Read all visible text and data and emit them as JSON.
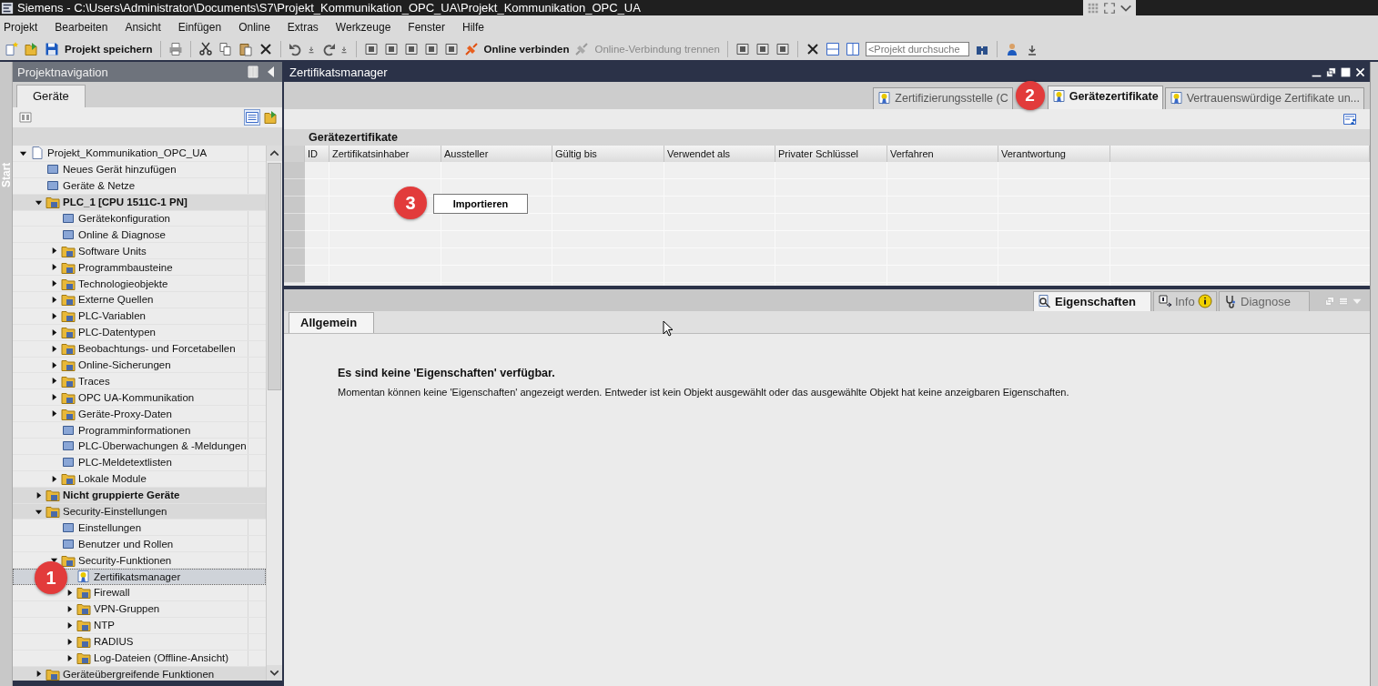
{
  "window": {
    "title": "Siemens  -  C:\\Users\\Administrator\\Documents\\S7\\Projekt_Kommunikation_OPC_UA\\Projekt_Kommunikation_OPC_UA"
  },
  "menu": [
    "Projekt",
    "Bearbeiten",
    "Ansicht",
    "Einfügen",
    "Online",
    "Extras",
    "Werkzeuge",
    "Fenster",
    "Hilfe"
  ],
  "toolbar": {
    "save": {
      "label": "Projekt speichern",
      "disabled": false
    },
    "connect": {
      "label": "Online verbinden",
      "disabled": false
    },
    "disconnect": {
      "label": "Online-Verbindung trennen",
      "disabled": true
    },
    "search": {
      "placeholder": "<Projekt durchsuche"
    }
  },
  "start_strip": {
    "label": "Start"
  },
  "navigation": {
    "title": "Projektnavigation",
    "tabs": [
      {
        "label": "Geräte",
        "selected": true
      }
    ],
    "tree": [
      {
        "label": "Projekt_Kommunikation_OPC_UA",
        "expanded": true,
        "selected": false,
        "children": [
          {
            "label": "Neues Gerät hinzufügen",
            "selected": false
          },
          {
            "label": "Geräte & Netze",
            "selected": false
          },
          {
            "label": "PLC_1 [CPU 1511C-1 PN]",
            "expanded": true,
            "bold": true,
            "selected": false,
            "children": [
              {
                "label": "Gerätekonfiguration",
                "selected": false
              },
              {
                "label": "Online & Diagnose",
                "selected": false
              },
              {
                "label": "Software Units",
                "expanded": false,
                "selected": false
              },
              {
                "label": "Programmbausteine",
                "expanded": false,
                "selected": false
              },
              {
                "label": "Technologieobjekte",
                "expanded": false,
                "selected": false
              },
              {
                "label": "Externe Quellen",
                "expanded": false,
                "selected": false
              },
              {
                "label": "PLC-Variablen",
                "expanded": false,
                "selected": false
              },
              {
                "label": "PLC-Datentypen",
                "expanded": false,
                "selected": false
              },
              {
                "label": "Beobachtungs- und Forcetabellen",
                "expanded": false,
                "selected": false
              },
              {
                "label": "Online-Sicherungen",
                "expanded": false,
                "selected": false
              },
              {
                "label": "Traces",
                "expanded": false,
                "selected": false
              },
              {
                "label": "OPC UA-Kommunikation",
                "expanded": false,
                "selected": false
              },
              {
                "label": "Geräte-Proxy-Daten",
                "expanded": false,
                "selected": false
              },
              {
                "label": "Programminformationen",
                "selected": false
              },
              {
                "label": "PLC-Überwachungen & -Meldungen",
                "selected": false
              },
              {
                "label": "PLC-Meldetextlisten",
                "selected": false
              },
              {
                "label": "Lokale Module",
                "expanded": false,
                "selected": false
              }
            ]
          },
          {
            "label": "Nicht gruppierte Geräte",
            "expanded": false,
            "bold": true,
            "selected": false
          },
          {
            "label": "Security-Einstellungen",
            "expanded": true,
            "selected": false,
            "children": [
              {
                "label": "Einstellungen",
                "selected": false
              },
              {
                "label": "Benutzer und Rollen",
                "selected": false
              },
              {
                "label": "Security-Funktionen",
                "expanded": true,
                "selected": false,
                "children": [
                  {
                    "label": "Zertifikatsmanager",
                    "selected": true
                  },
                  {
                    "label": "Firewall",
                    "expanded": false,
                    "selected": false
                  },
                  {
                    "label": "VPN-Gruppen",
                    "expanded": false,
                    "selected": false
                  },
                  {
                    "label": "NTP",
                    "expanded": false,
                    "selected": false
                  },
                  {
                    "label": "RADIUS",
                    "expanded": false,
                    "selected": false
                  },
                  {
                    "label": "Log-Dateien (Offline-Ansicht)",
                    "expanded": false,
                    "selected": false
                  }
                ]
              }
            ]
          },
          {
            "label": "Geräteübergreifende Funktionen",
            "expanded": false,
            "selected": false
          }
        ]
      }
    ]
  },
  "editor": {
    "title": "Zertifikatsmanager",
    "tabs": [
      {
        "label": "Zertifizierungsstelle (C",
        "selected": false
      },
      {
        "label": "Gerätezertifikate",
        "selected": true
      },
      {
        "label": "Vertrauenswürdige Zertifikate un...",
        "selected": false
      }
    ],
    "table": {
      "title": "Gerätezertifikate",
      "columns": [
        "ID",
        "Zertifikatsinhaber",
        "Aussteller",
        "Gültig bis",
        "Verwendet als",
        "Privater Schlüssel",
        "Verfahren",
        "Verantwortung"
      ]
    },
    "import_button": "Importieren"
  },
  "inspector": {
    "tabs": [
      {
        "label": "Eigenschaften",
        "selected": true
      },
      {
        "label": "Info",
        "selected": false
      },
      {
        "label": "Diagnose",
        "selected": false
      }
    ],
    "subtabs": [
      {
        "label": "Allgemein",
        "selected": true
      }
    ],
    "heading": "Es sind keine 'Eigenschaften' verfügbar.",
    "message": "Momentan können keine 'Eigenschaften' angezeigt werden. Entweder ist kein Objekt ausgewählt oder das ausgewählte Objekt hat keine anzeigbaren Eigenschaften."
  },
  "callouts": [
    {
      "number": "1"
    },
    {
      "number": "2"
    },
    {
      "number": "3"
    }
  ]
}
